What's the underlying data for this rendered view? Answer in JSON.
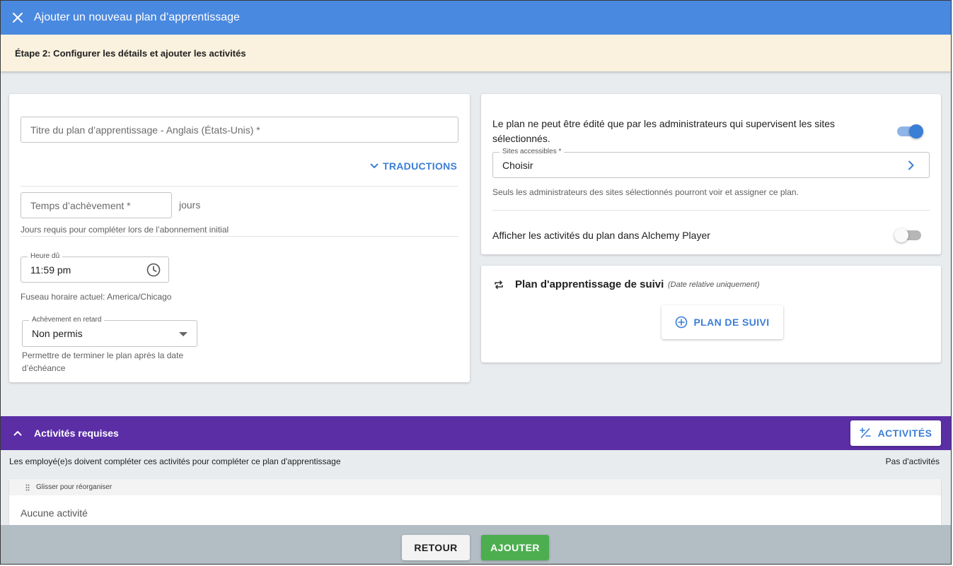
{
  "dialog": {
    "title": "Ajouter un nouveau plan d’apprentissage",
    "step": "Étape 2: Configurer les détails et ajouter les activités"
  },
  "details": {
    "title_field_placeholder": "Titre du plan d’apprentissage - Anglais (États-Unis) *",
    "translations_label": "TRADUCTIONS",
    "completion_time_placeholder": "Temps d’achèvement *",
    "completion_time_unit": "jours",
    "completion_time_helper": "Jours requis pour compléter lors de l’abonnement initial",
    "due_time_label": "Heure dû",
    "due_time_value": "11:59 pm",
    "timezone_text": "Fuseau horaire actuel: America/Chicago",
    "late_completion_label": "Achèvement en retard",
    "late_completion_value": "Non permis",
    "late_completion_helper_line1": "Permettre de terminer le plan après la date",
    "late_completion_helper_line2": "d’échéance"
  },
  "permissions": {
    "admin_edit_text_line1": "Le plan ne peut être édité que par les administrateurs qui supervisent les sites",
    "admin_edit_text_line2": "sélectionnés.",
    "admin_edit_enabled": true,
    "sites_label": "Sites accessibles *",
    "sites_value": "Choisir",
    "sites_helper": "Seuls les administrateurs des sites sélectionnés pourront voir et assigner ce plan.",
    "show_in_player_text": "Afficher les activités du plan dans Alchemy Player",
    "show_in_player_enabled": false
  },
  "followup": {
    "title": "Plan d'apprentissage de suivi",
    "subtitle": "(Date relative uniquement)",
    "button_label": "PLAN DE SUIVI"
  },
  "required_activities": {
    "title": "Activités requises",
    "add_button_label": "ACTIVITÉS",
    "description": "Les employé(e)s doivent compléter ces activités pour compléter ce plan d'apprentissage",
    "count_text": "Pas d'activités",
    "drag_hint": "Glisser pour réorganiser",
    "empty_text": "Aucune activité"
  },
  "footer": {
    "back_label": "RETOUR",
    "add_label": "AJOUTER"
  },
  "colors": {
    "header_blue": "#4a89e0",
    "step_banner": "#faf1de",
    "accent_blue": "#3b7ed6",
    "purple": "#5b2ea6",
    "success_green": "#4cae4f",
    "footer_gray": "#b3bdc4"
  }
}
